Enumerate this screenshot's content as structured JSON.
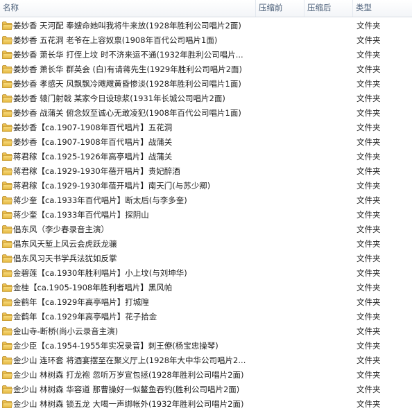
{
  "columns": {
    "name": "名称",
    "compressed_size": "压缩前",
    "original_size": "压缩后",
    "type": "类型"
  },
  "rows": [
    {
      "name": "姜妙香 天河配 奉嫂命她叫我将牛来放(1928年胜利公司唱片2面)",
      "type": "文件夹"
    },
    {
      "name": "姜妙香 五花洞 老爷在上容奴禀(1908年百代公司唱片1面)",
      "type": "文件夹"
    },
    {
      "name": "姜妙香 萧长华 打侄上坟 时不济来运不通(1932年胜利公司唱片...",
      "type": "文件夹"
    },
    {
      "name": "姜妙香 萧长华 群英会 (白)有请蒋先生(1929年胜利公司唱片2面)",
      "type": "文件夹"
    },
    {
      "name": "姜妙香 孝感天 风飘飘冷飕飕黄昏惨淡(1928年胜利公司唱片1面)",
      "type": "文件夹"
    },
    {
      "name": "姜妙香 辕门射戟 某家今日设琼浆(1931年长城公司唱片2面)",
      "type": "文件夹"
    },
    {
      "name": "姜妙香 战蒲关 俯念奴至诚心无敢凌犯(1908年百代公司唱片1面)",
      "type": "文件夹"
    },
    {
      "name": "姜妙香【ca.1907-1908年百代唱片】五花洞",
      "type": "文件夹"
    },
    {
      "name": "姜妙香【ca.1907-1908年百代唱片】战蒲关",
      "type": "文件夹"
    },
    {
      "name": "蒋君稼【ca.1925-1926年高亭唱片】战蒲关",
      "type": "文件夹"
    },
    {
      "name": "蒋君稼【ca.1929-1930年蓓开唱片】贵妃醉酒",
      "type": "文件夹"
    },
    {
      "name": "蒋君稼【ca.1929-1930年蓓开唱片】南天门(与苏少卿)",
      "type": "文件夹"
    },
    {
      "name": "蒋少奎【ca.1933年百代唱片】断太后(与李多奎)",
      "type": "文件夹"
    },
    {
      "name": "蒋少奎【ca.1933年百代唱片】探阴山",
      "type": "文件夹"
    },
    {
      "name": "倡东风（李少春录音主演）",
      "type": "文件夹"
    },
    {
      "name": "倡东风天堑上风云会虎跃龙骧",
      "type": "文件夹"
    },
    {
      "name": "倡东风习天书学兵法犹如反掌",
      "type": "文件夹"
    },
    {
      "name": "金碧莲【ca.1930年胜利唱片】小上坟(与刘坤华)",
      "type": "文件夹"
    },
    {
      "name": "金桂【ca.1905-1908年胜利者唱片】黑风帕",
      "type": "文件夹"
    },
    {
      "name": "金鹤年【ca.1929年高亭唱片】打城隍",
      "type": "文件夹"
    },
    {
      "name": "金鹤年【ca.1929年高亭唱片】花子拾金",
      "type": "文件夹"
    },
    {
      "name": "金山寺-断桥(尚小云录音主演)",
      "type": "文件夹"
    },
    {
      "name": "金少臣【ca.1954-1955年实况录音】刺王僚(杨宝忠操琴)",
      "type": "文件夹"
    },
    {
      "name": "金少山 连环套 将酒宴摆至在聚义厅上(1928年大中华公司唱片2...",
      "type": "文件夹"
    },
    {
      "name": "金少山 林树森 打龙袍 忽听万岁宣包拯(1928年胜利公司唱片2面)",
      "type": "文件夹"
    },
    {
      "name": "金少山 林树森 华容道 那曹操好一似鳌鱼吞钓(胜利公司唱片2面)",
      "type": "文件夹"
    },
    {
      "name": "金少山 林树森 锁五龙 大喝一声绑帐外(1932年胜利公司唱片2面)",
      "type": "文件夹"
    }
  ]
}
